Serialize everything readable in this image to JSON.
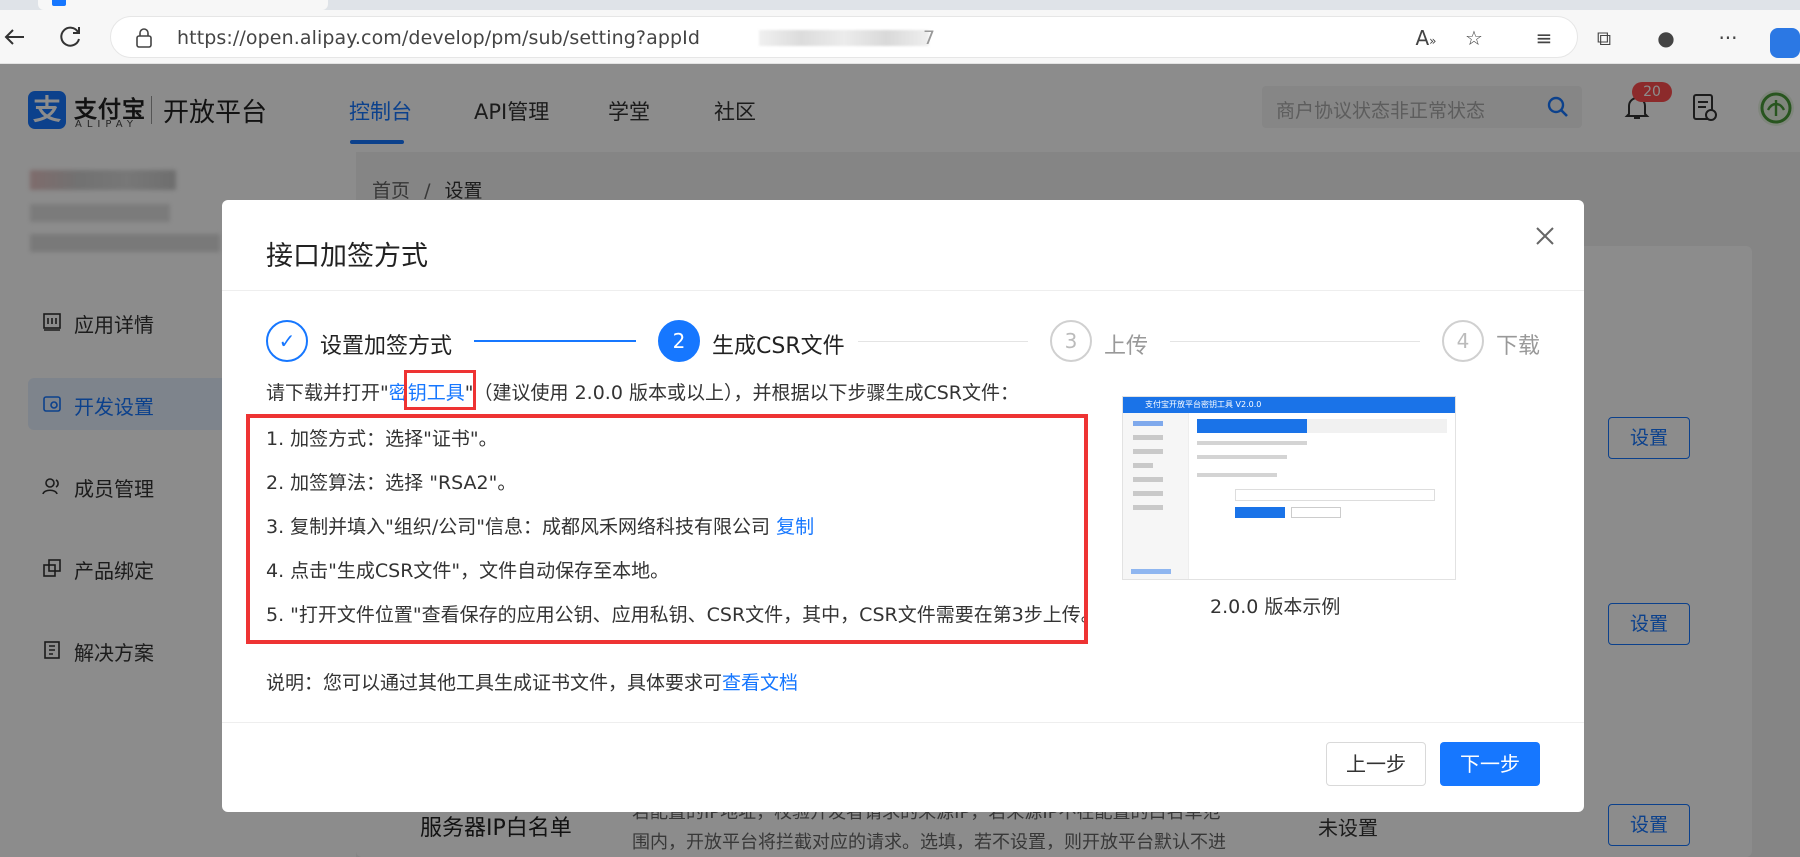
{
  "browser": {
    "url": "https://open.alipay.com/develop/pm/sub/setting?appId",
    "url_tail": "7"
  },
  "header": {
    "logo_cn": "支付宝",
    "logo_en": "ALIPAY",
    "platform": "开放平台",
    "nav": [
      "控制台",
      "API管理",
      "学堂",
      "社区"
    ],
    "search_placeholder": "商户协议状态非正常状态",
    "notification_count": "20"
  },
  "breadcrumb": {
    "home": "首页",
    "sep": "/",
    "current": "设置"
  },
  "sidebar": {
    "items": [
      {
        "label": "应用详情",
        "icon": "app-detail-icon"
      },
      {
        "label": "开发设置",
        "icon": "dev-settings-icon"
      },
      {
        "label": "成员管理",
        "icon": "members-icon"
      },
      {
        "label": "产品绑定",
        "icon": "product-bind-icon"
      },
      {
        "label": "解决方案",
        "icon": "solution-icon"
      }
    ]
  },
  "background_rows": {
    "set_label": "设置",
    "ip_whitelist_title": "服务器IP白名单",
    "ip_whitelist_desc_1": "若配置的IP地址，校验开发者请求的来源IP，若来源IP不在配置的白名单范",
    "ip_whitelist_desc_2": "围内，开放平台将拦截对应的请求。选填，若不设置，则开放平台默认不进",
    "ip_whitelist_status": "未设置"
  },
  "modal": {
    "title": "接口加签方式",
    "steps": [
      {
        "num": "✓",
        "label": "设置加签方式"
      },
      {
        "num": "2",
        "label": "生成CSR文件"
      },
      {
        "num": "3",
        "label": "上传"
      },
      {
        "num": "4",
        "label": "下载"
      }
    ],
    "intro_prefix": "请下载并打开",
    "intro_quote_open": "\"",
    "intro_link": "密钥工具",
    "intro_quote_close": "\"",
    "intro_suffix": "（建议使用 2.0.0 版本或以上），并根据以下步骤生成CSR文件：",
    "instructions": [
      "1. 加签方式：选择\"证书\"。",
      "2. 加签算法：选择 \"RSA2\"。",
      "3. 复制并填入\"组织/公司\"信息：成都风禾网络科技有限公司",
      "4. 点击\"生成CSR文件\"，文件自动保存至本地。",
      "5. \"打开文件位置\"查看保存的应用公钥、应用私钥、CSR文件，其中，CSR文件需要在第3步上传。"
    ],
    "copy_link": "复制",
    "note_prefix": "说明：您可以通过其他工具生成证书文件，具体要求可",
    "note_link": "查看文档",
    "preview_title": "支付宝开放平台密钥工具 V2.0.0",
    "preview_caption": "2.0.0 版本示例",
    "prev_button": "上一步",
    "next_button": "下一步"
  },
  "colors": {
    "primary": "#1677ff",
    "highlight": "#ee3333",
    "badge": "#ff4d4f"
  }
}
